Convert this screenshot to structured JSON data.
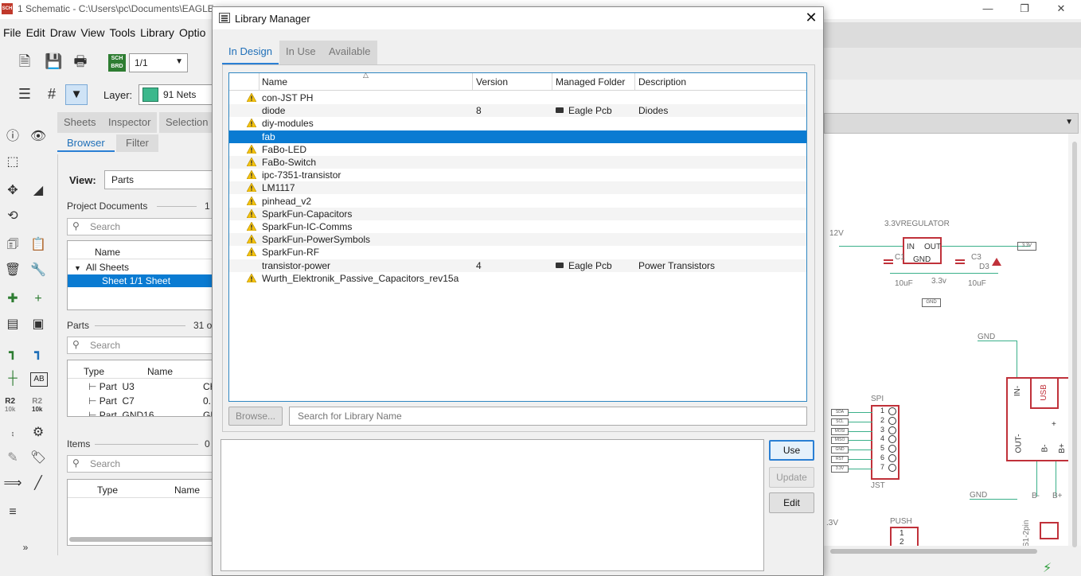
{
  "main_window": {
    "title": "1 Schematic - C:\\Users\\pc\\Documents\\EAGLE",
    "app_icon_text": "SCH",
    "menu": [
      "File",
      "Edit",
      "Draw",
      "View",
      "Tools",
      "Library",
      "Optio"
    ]
  },
  "toolbar": {
    "sheet_selector": "1/1",
    "sch_brd_icon": "SCH BRD",
    "layer_label": "Layer:",
    "layer_value": "91 Nets",
    "layer_color": "#3cb88c"
  },
  "panel": {
    "tabs": [
      "Sheets",
      "Inspector",
      "Selection F"
    ],
    "subtabs": [
      "Browser",
      "Filter"
    ],
    "view_label": "View:",
    "view_value": "Parts",
    "project_documents": {
      "title": "Project Documents",
      "count": "1",
      "search_placeholder": "Search",
      "column": "Name",
      "tree": [
        {
          "label": "All Sheets"
        },
        {
          "label": "Sheet 1/1  Sheet"
        }
      ]
    },
    "parts": {
      "title": "Parts",
      "count": "31 o",
      "search_placeholder": "Search",
      "columns": [
        "Type",
        "Name"
      ],
      "rows": [
        {
          "type": "Part",
          "name": "U3",
          "extra": "CH"
        },
        {
          "type": "Part",
          "name": "C7",
          "extra": "0."
        },
        {
          "type": "Part",
          "name": "GND16",
          "extra": "GN"
        }
      ]
    },
    "items": {
      "title": "Items",
      "count": "0",
      "search_placeholder": "Search",
      "columns": [
        "Type",
        "Name"
      ]
    }
  },
  "left_tools": {
    "r2_top": "R2",
    "r2_top_sub": "10k",
    "r2_bottom": "R2",
    "r2_bottom_sub": "10k",
    "ab_label": "AB"
  },
  "schematic": {
    "voltage_12v": "12V",
    "regulator_label": "3.3VREGULATOR",
    "reg_in": "IN",
    "reg_out": "OUT",
    "reg_gnd": "GND",
    "cap1": "C1",
    "cap3": "C3",
    "cap1_val": "10uF",
    "cap3_val": "10uF",
    "diode": "D3",
    "net_33v": "3.3v",
    "net_33v_tag": "3.3V",
    "gnd_tag": "GND",
    "gnd_label_1": "GND",
    "gnd_label_2": "GND",
    "usb_label": "USB",
    "usb_in": "IN-",
    "usb_out": "OUT-",
    "usb_b_minus": "B-",
    "usb_b_plus": "B+",
    "usb_b_minus_lbl": "B-",
    "usb_b_plus_lbl": "B+",
    "usb_plus": "+",
    "spi_label": "SPI",
    "jst_label": "JST",
    "spi_pins": [
      "SDA",
      "SCL",
      "MOSI",
      "MISO",
      "GND",
      "RST",
      "3.3V"
    ],
    "spi_numbers": [
      "1",
      "2",
      "3",
      "4",
      "5",
      "6",
      "7"
    ],
    "push_label": "PUSH",
    "push_pins": [
      "1",
      "2"
    ],
    "bottom_left_label": ".3V",
    "bottom_right_label": "S1-2pin"
  },
  "library_manager": {
    "title": "Library Manager",
    "tabs": [
      "In Design",
      "In Use",
      "Available"
    ],
    "columns": {
      "name": "Name",
      "version": "Version",
      "folder": "Managed Folder",
      "description": "Description"
    },
    "rows": [
      {
        "name": "con-JST PH",
        "warn": true,
        "version": "",
        "folder": "",
        "description": ""
      },
      {
        "name": "diode",
        "warn": false,
        "version": "8",
        "folder": "Eagle Pcb",
        "description": "Diodes"
      },
      {
        "name": "diy-modules",
        "warn": true,
        "version": "",
        "folder": "",
        "description": ""
      },
      {
        "name": "fab",
        "warn": false,
        "version": "",
        "folder": "",
        "description": "",
        "selected": true
      },
      {
        "name": "FaBo-LED",
        "warn": true,
        "version": "",
        "folder": "",
        "description": ""
      },
      {
        "name": "FaBo-Switch",
        "warn": true,
        "version": "",
        "folder": "",
        "description": ""
      },
      {
        "name": "ipc-7351-transistor",
        "warn": true,
        "version": "",
        "folder": "",
        "description": ""
      },
      {
        "name": "LM1117",
        "warn": true,
        "version": "",
        "folder": "",
        "description": ""
      },
      {
        "name": "pinhead_v2",
        "warn": true,
        "version": "",
        "folder": "",
        "description": ""
      },
      {
        "name": "SparkFun-Capacitors",
        "warn": true,
        "version": "",
        "folder": "",
        "description": ""
      },
      {
        "name": "SparkFun-IC-Comms",
        "warn": true,
        "version": "",
        "folder": "",
        "description": ""
      },
      {
        "name": "SparkFun-PowerSymbols",
        "warn": true,
        "version": "",
        "folder": "",
        "description": ""
      },
      {
        "name": "SparkFun-RF",
        "warn": true,
        "version": "",
        "folder": "",
        "description": ""
      },
      {
        "name": "transistor-power",
        "warn": false,
        "version": "4",
        "folder": "Eagle Pcb",
        "description": "Power Transistors"
      },
      {
        "name": "Wurth_Elektronik_Passive_Capacitors_rev15a",
        "warn": true,
        "version": "",
        "folder": "",
        "description": ""
      }
    ],
    "browse_label": "Browse...",
    "search_placeholder": "Search for Library Name",
    "buttons": {
      "use": "Use",
      "update": "Update",
      "edit": "Edit"
    }
  }
}
